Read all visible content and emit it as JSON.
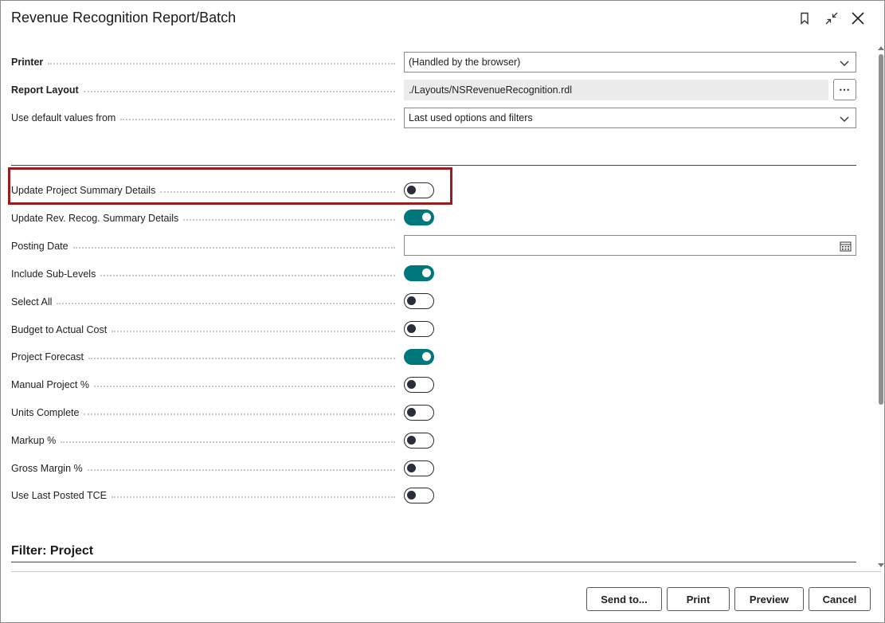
{
  "dialog": {
    "title": "Revenue Recognition Report/Batch",
    "header_icons": [
      "bookmark-icon",
      "collapse-icon",
      "close-icon"
    ]
  },
  "options": {
    "printer": {
      "label": "Printer",
      "value": "(Handled by the browser)"
    },
    "report_layout": {
      "label": "Report Layout",
      "value": "./Layouts/NSRevenueRecognition.rdl",
      "more_label": "⋯"
    },
    "default_values": {
      "label": "Use default values from",
      "value": "Last used options and filters"
    }
  },
  "settings": {
    "update_project_summary": {
      "label": "Update Project Summary Details",
      "on": false
    },
    "update_rev_recog_summary": {
      "label": "Update Rev. Recog. Summary Details",
      "on": true
    },
    "posting_date": {
      "label": "Posting Date",
      "value": ""
    },
    "include_sub_levels": {
      "label": "Include Sub-Levels",
      "on": true
    },
    "select_all": {
      "label": "Select All",
      "on": false
    },
    "budget_to_actual_cost": {
      "label": "Budget to Actual Cost",
      "on": false
    },
    "project_forecast": {
      "label": "Project Forecast",
      "on": true
    },
    "manual_project_pct": {
      "label": "Manual Project %",
      "on": false
    },
    "units_complete": {
      "label": "Units Complete",
      "on": false
    },
    "markup_pct": {
      "label": "Markup %",
      "on": false
    },
    "gross_margin_pct": {
      "label": "Gross Margin %",
      "on": false
    },
    "use_last_posted_tce": {
      "label": "Use Last Posted TCE",
      "on": false
    }
  },
  "filter": {
    "title": "Filter: Project"
  },
  "footer": {
    "send_to": "Send to...",
    "print": "Print",
    "preview": "Preview",
    "cancel": "Cancel"
  },
  "colors": {
    "toggle_on": "#00777b",
    "highlight_border": "#9b1c1f"
  }
}
